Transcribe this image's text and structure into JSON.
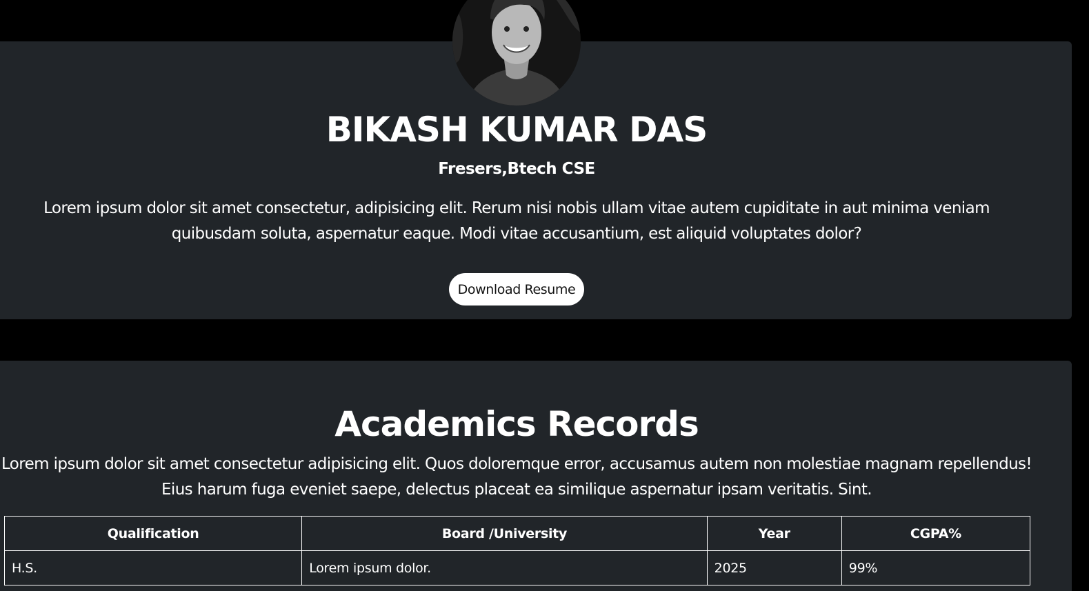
{
  "hero": {
    "name": "BIKASH KUMAR DAS",
    "subtitle": "Fresers,Btech CSE",
    "description": "Lorem ipsum dolor sit amet consectetur, adipisicing elit. Rerum nisi nobis ullam vitae autem cupiditate in aut minima veniam quibusdam soluta, aspernatur eaque. Modi vitae accusantium, est aliquid voluptates dolor?",
    "download_label": "Download Resume",
    "avatar_icon": "profile-photo"
  },
  "academics": {
    "title": "Academics Records",
    "description": "Lorem ipsum dolor sit amet consectetur adipisicing elit. Quos doloremque error, accusamus autem non molestiae magnam repellendus! Eius harum fuga eveniet saepe, delectus placeat ea similique aspernatur ipsam veritatis. Sint.",
    "columns": [
      "Qualification",
      "Board /University",
      "Year",
      "CGPA%"
    ],
    "rows": [
      [
        "H.S.",
        "Lorem ipsum dolor.",
        "2025",
        "99%"
      ]
    ]
  },
  "colors": {
    "page_bg": "#000000",
    "card_bg": "#212529",
    "text": "#ffffff",
    "button_bg": "#ffffff",
    "button_text": "#111111"
  }
}
